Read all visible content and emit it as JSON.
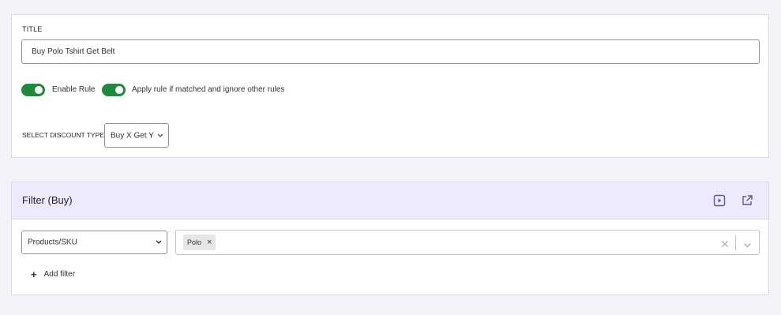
{
  "general": {
    "title_label": "TITLE",
    "title_value": "Buy Polo Tshirt Get Belt",
    "enable_rule_label": "Enable Rule",
    "enable_rule_on": true,
    "apply_rule_label": "Apply rule if matched and ignore other rules",
    "apply_rule_on": true,
    "discount_type_label": "SELECT DISCOUNT TYPE:",
    "discount_type_value": "Buy X Get Y"
  },
  "filter": {
    "title": "Filter (Buy)",
    "header_icons": [
      "play-icon",
      "external-link-icon"
    ],
    "type_value": "Products/SKU",
    "selected_tags": [
      "Polo"
    ],
    "add_filter_label": "Add filter"
  },
  "colors": {
    "toggle_on": "#1e8a3c",
    "filter_header_bg": "#ede9fe",
    "icon_purple": "#6b4fa0"
  }
}
